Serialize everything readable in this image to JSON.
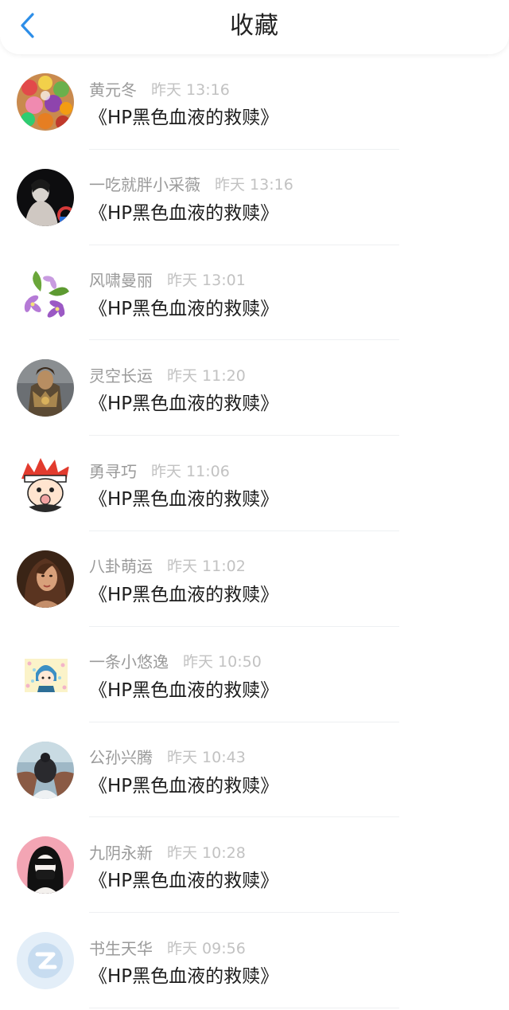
{
  "header": {
    "title": "收藏",
    "back_icon": "chevron-left-icon",
    "accent_color": "#2d8ee8"
  },
  "items": [
    {
      "name": "黄元冬",
      "time": "昨天 13:16",
      "content": "《HP黑色血液的救赎》",
      "avatar": "candy-avatar"
    },
    {
      "name": "一吃就胖小采薇",
      "time": "昨天 13:16",
      "content": "《HP黑色血液的救赎》",
      "avatar": "dark-portrait-avatar"
    },
    {
      "name": "风啸曼丽",
      "time": "昨天 13:01",
      "content": "《HP黑色血液的救赎》",
      "avatar": "purple-flowers-avatar"
    },
    {
      "name": "灵空长运",
      "time": "昨天 11:20",
      "content": "《HP黑色血液的救赎》",
      "avatar": "armored-warrior-avatar"
    },
    {
      "name": "勇寻巧",
      "time": "昨天 11:06",
      "content": "《HP黑色血液的救赎》",
      "avatar": "cartoon-red-hair-avatar"
    },
    {
      "name": "八卦萌运",
      "time": "昨天 11:02",
      "content": "《HP黑色血液的救赎》",
      "avatar": "woman-portrait-avatar"
    },
    {
      "name": "一条小悠逸",
      "time": "昨天 10:50",
      "content": "《HP黑色血液的救赎》",
      "avatar": "cartoon-boy-avatar"
    },
    {
      "name": "公孙兴腾",
      "time": "昨天 10:43",
      "content": "《HP黑色血液的救赎》",
      "avatar": "back-of-head-avatar"
    },
    {
      "name": "九阴永新",
      "time": "昨天 10:28",
      "content": "《HP黑色血液的救赎》",
      "avatar": "masked-person-avatar"
    },
    {
      "name": "书生天华",
      "time": "昨天 09:56",
      "content": "《HP黑色血液的救赎》",
      "avatar": "default-z-avatar"
    }
  ]
}
